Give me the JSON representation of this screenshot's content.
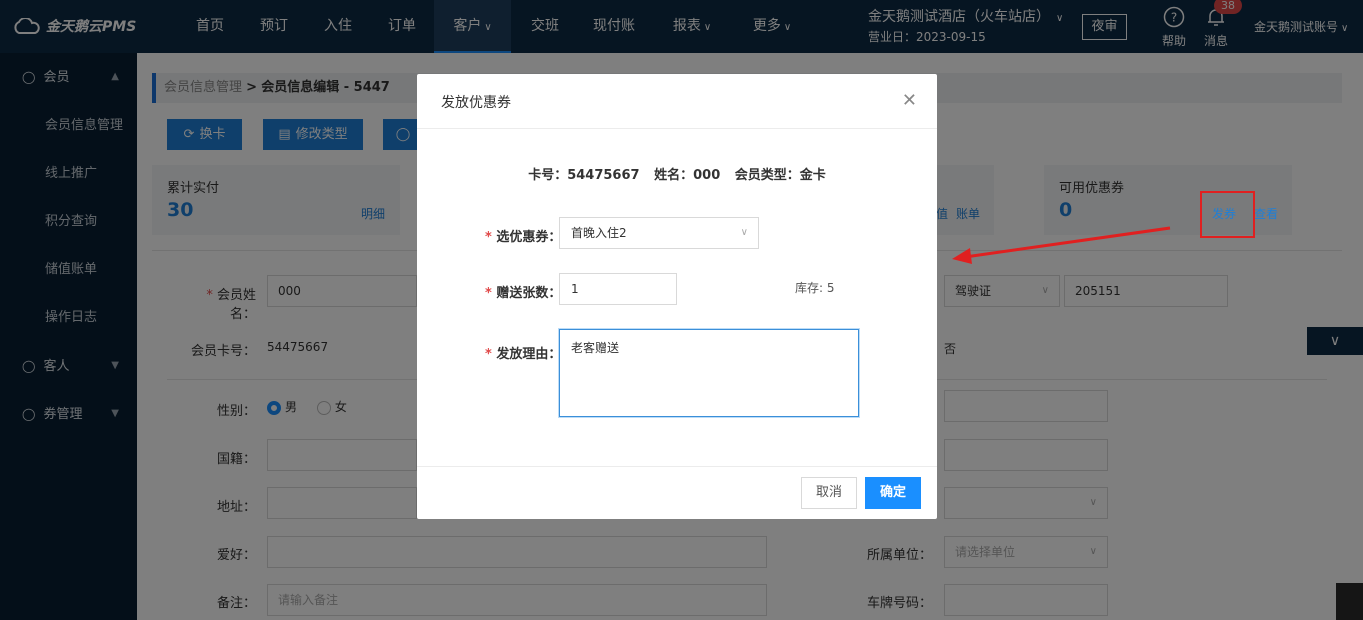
{
  "app": {
    "logo": "金天鹅云PMS"
  },
  "topnav": {
    "items": [
      "首页",
      "预订",
      "入住",
      "订单",
      "客户",
      "交班",
      "现付账",
      "报表",
      "更多"
    ],
    "hotel_name": "金天鹅测试酒店（火车站店）",
    "business_date": "营业日：2023-09-15",
    "night_audit": "夜审",
    "help": "帮助",
    "messages": "消息",
    "message_count": "38",
    "account": "金天鹅测试账号"
  },
  "sidebar": {
    "groups": [
      {
        "label": "会员",
        "items": [
          "会员信息管理",
          "线上推广",
          "积分查询",
          "储值账单",
          "操作日志"
        ]
      },
      {
        "label": "客人"
      },
      {
        "label": "券管理"
      }
    ]
  },
  "page": {
    "breadcrumb_parent": "会员信息管理",
    "breadcrumb_sep": ">",
    "breadcrumb_current": "会员信息编辑 - 5447",
    "buttons": {
      "change_card": "换卡",
      "modify_type": "修改类型"
    },
    "stats": {
      "actual_total": {
        "label": "累计实付",
        "value": "30",
        "link": "明细"
      },
      "bill_links": {
        "link_a": "值",
        "link_b": "账单"
      },
      "coupons": {
        "label": "可用优惠券",
        "value": "0",
        "issue": "发券",
        "view": "查看"
      }
    },
    "form": {
      "member_name_label": "会员姓名：",
      "member_name_value": "000",
      "card_no_label": "会员卡号：",
      "card_no_value": "54475667",
      "id_type_value": "驾驶证",
      "id_no_value": "205151",
      "no_value": "否",
      "gender_label": "性别：",
      "gender_male": "男",
      "gender_female": "女",
      "nationality_label": "国籍：",
      "address_label": "地址：",
      "hobby_label": "爱好：",
      "remark_label": "备注：",
      "remark_placeholder": "请输入备注",
      "unit_label": "所属单位：",
      "unit_placeholder": "请选择单位",
      "plate_label": "车牌号码："
    }
  },
  "modal": {
    "title": "发放优惠券",
    "info_card": "卡号：54475667",
    "info_name": "姓名：000",
    "info_type": "会员类型：金卡",
    "coupon_label": "选优惠券：",
    "coupon_value": "首晚入住2",
    "qty_label": "赠送张数：",
    "qty_value": "1",
    "stock": "库存: 5",
    "reason_label": "发放理由：",
    "reason_value": "老客赠送",
    "cancel": "取消",
    "confirm": "确定"
  },
  "colors": {
    "nav_bg": "#0d2a44",
    "sidebar_bg": "#091f33",
    "accent": "#1a8fff",
    "highlight": "#e02020"
  }
}
